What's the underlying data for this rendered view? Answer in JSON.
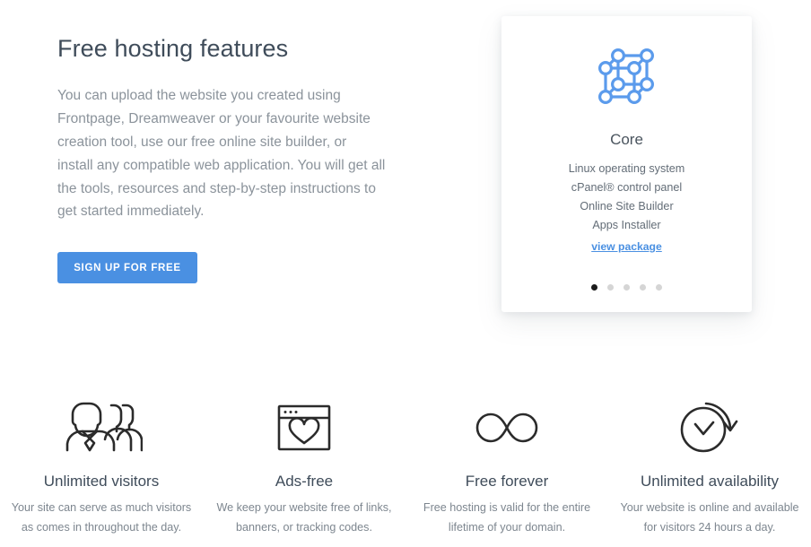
{
  "hero": {
    "title": "Free hosting features",
    "body": "You can upload the website you created using Frontpage, Dreamweaver or your favourite website creation tool, use our free online site builder, or install any compatible web application. You will get all the tools, resources and step-by-step instructions to get started immediately.",
    "cta_label": "SIGN UP FOR FREE",
    "cta_color": "#4a90e2"
  },
  "card": {
    "icon": "cube-network-icon",
    "icon_color": "#5b9bec",
    "title": "Core",
    "features": [
      "Linux operating system",
      "cPanel® control panel",
      "Online Site Builder",
      "Apps Installer"
    ],
    "link_label": "view package",
    "link_color": "#4a90e2",
    "carousel": {
      "total": 5,
      "active_index": 0,
      "active_color": "#1b1b1b",
      "inactive_color": "#d5d5d5"
    }
  },
  "features": [
    {
      "icon": "users-group-icon",
      "title": "Unlimited visitors",
      "desc": "Your site can serve as much visitors as comes in throughout the day."
    },
    {
      "icon": "browser-heart-icon",
      "title": "Ads-free",
      "desc": "We keep your website free of links, banners, or tracking codes."
    },
    {
      "icon": "infinity-icon",
      "title": "Free forever",
      "desc": "Free hosting is valid for the entire lifetime of your domain."
    },
    {
      "icon": "clock-refresh-icon",
      "title": "Unlimited availability",
      "desc": "Your website is online and available for visitors 24 hours a day."
    }
  ]
}
